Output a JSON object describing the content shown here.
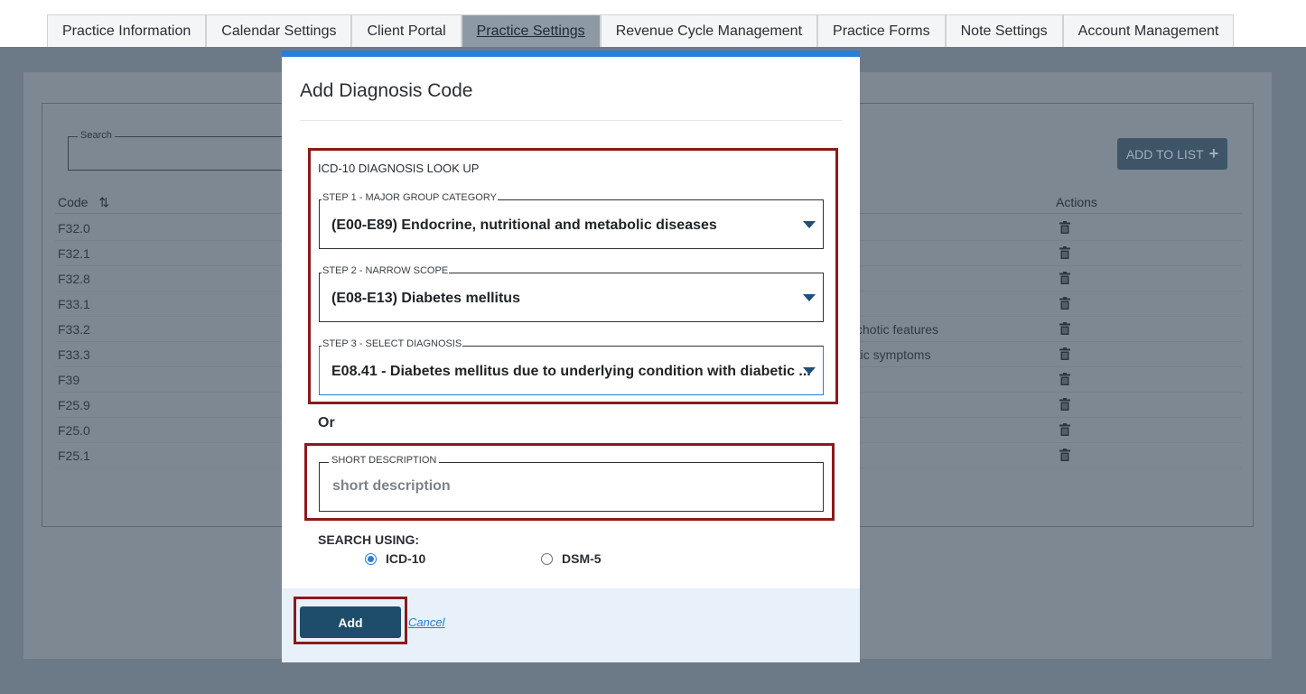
{
  "tabs": [
    {
      "label": "Practice Information",
      "active": false
    },
    {
      "label": "Calendar Settings",
      "active": false
    },
    {
      "label": "Client Portal",
      "active": false
    },
    {
      "label": "Practice Settings",
      "active": true
    },
    {
      "label": "Revenue Cycle Management",
      "active": false
    },
    {
      "label": "Practice Forms",
      "active": false
    },
    {
      "label": "Note Settings",
      "active": false
    },
    {
      "label": "Account Management",
      "active": false
    }
  ],
  "background": {
    "search_label": "Search",
    "add_to_list_label": "ADD TO LIST",
    "columns": {
      "code": "Code",
      "actions": "Actions"
    },
    "rows": [
      {
        "code": "F32.0",
        "desc": ""
      },
      {
        "code": "F32.1",
        "desc": ""
      },
      {
        "code": "F32.8",
        "desc": ""
      },
      {
        "code": "F33.1",
        "desc": ""
      },
      {
        "code": "F33.2",
        "desc": "ychotic features"
      },
      {
        "code": "F33.3",
        "desc": "otic symptoms"
      },
      {
        "code": "F39",
        "desc": ""
      },
      {
        "code": "F25.9",
        "desc": ""
      },
      {
        "code": "F25.0",
        "desc": ""
      },
      {
        "code": "F25.1",
        "desc": ""
      }
    ]
  },
  "modal": {
    "title": "Add Diagnosis Code",
    "lookup_title": "ICD-10 DIAGNOSIS LOOK UP",
    "step1": {
      "label": "STEP 1 - MAJOR GROUP CATEGORY",
      "value": "(E00-E89) Endocrine, nutritional and metabolic diseases"
    },
    "step2": {
      "label": "STEP 2 - NARROW SCOPE",
      "value": "(E08-E13) Diabetes mellitus"
    },
    "step3": {
      "label": "STEP 3 - SELECT DIAGNOSIS",
      "value": "E08.41 - Diabetes mellitus due to underlying condition with diabetic ..."
    },
    "or_label": "Or",
    "short_description": {
      "label": "SHORT DESCRIPTION",
      "placeholder": "short description",
      "value": ""
    },
    "search_using_label": "SEARCH USING:",
    "search_options": [
      {
        "label": "ICD-10",
        "checked": true
      },
      {
        "label": "DSM-5",
        "checked": false
      }
    ],
    "add_label": "Add",
    "cancel_label": "Cancel"
  },
  "colors": {
    "accent": "#2a7ed8",
    "primary_button": "#1d4d6b",
    "highlight_box": "#8b1a1a"
  }
}
